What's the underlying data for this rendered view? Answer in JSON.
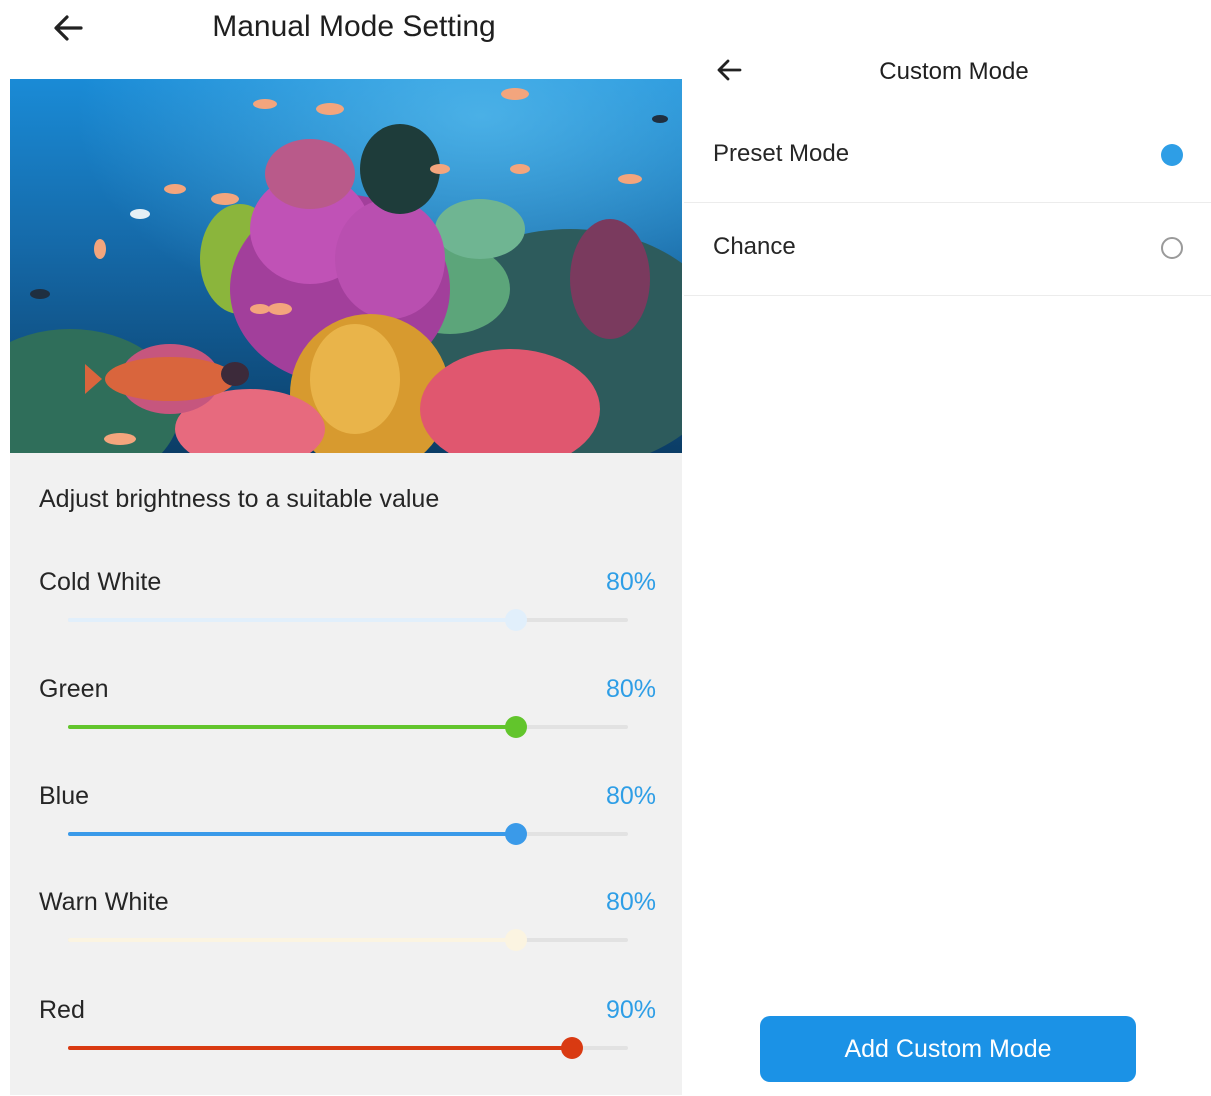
{
  "manual_mode": {
    "title": "Manual Mode Setting",
    "back_icon": "arrow-left-icon",
    "hint": "Adjust brightness to a suitable value",
    "sliders": [
      {
        "label": "Cold White",
        "value_text": "80%",
        "value": 0.8,
        "color": "#e1effb"
      },
      {
        "label": "Green",
        "value_text": "80%",
        "value": 0.8,
        "color": "#62c52c"
      },
      {
        "label": "Blue",
        "value_text": "80%",
        "value": 0.8,
        "color": "#3a9ae9"
      },
      {
        "label": "Warn White",
        "value_text": "80%",
        "value": 0.8,
        "color": "#fbf4e1"
      },
      {
        "label": "Red",
        "value_text": "90%",
        "value": 0.9,
        "color": "#d93a12"
      }
    ]
  },
  "custom_mode": {
    "title": "Custom Mode",
    "back_icon": "arrow-left-icon",
    "options": [
      {
        "label": "Preset Mode",
        "selected": true
      },
      {
        "label": "Chance",
        "selected": false
      }
    ],
    "add_button_label": "Add Custom Mode"
  },
  "colors": {
    "accent": "#1b92e6",
    "value_text": "#2e9ee6",
    "panel_bg": "#f1f1f1"
  }
}
